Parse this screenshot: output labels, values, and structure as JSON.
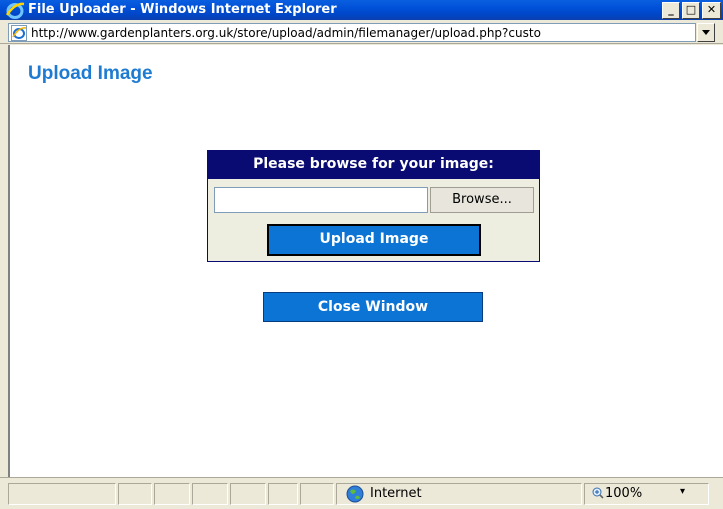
{
  "window": {
    "title": "File Uploader - Windows Internet Explorer",
    "minimize_glyph": "_",
    "maximize_glyph": "□",
    "close_glyph": "✕"
  },
  "address_bar": {
    "url": "http://www.gardenplanters.org.uk/store/upload/admin/filemanager/upload.php?custo"
  },
  "page": {
    "title": "Upload Image",
    "upload_panel": {
      "header": "Please browse for your image:",
      "file_value": "",
      "browse_label": "Browse...",
      "upload_label": "Upload Image"
    },
    "close_label": "Close Window"
  },
  "status_bar": {
    "zone": "Internet",
    "zoom": "100%",
    "zoom_dropdown_glyph": "▾"
  },
  "icons": {
    "ie_logo": "ie-logo-icon",
    "page": "ie-page-icon",
    "globe": "globe-icon",
    "zoom": "zoom-icon"
  },
  "colors": {
    "title_bar": "#0050d8",
    "page_title": "#1e7bd2",
    "panel_header": "#0a0a73",
    "button": "#0b74d4"
  }
}
